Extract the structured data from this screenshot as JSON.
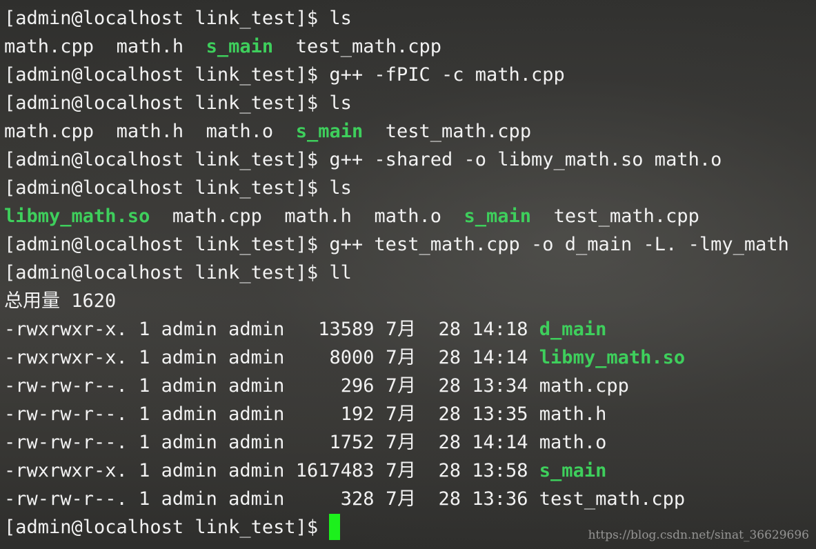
{
  "terminal": {
    "prompt": "[admin@localhost link_test]$ ",
    "lines": [
      {
        "kind": "cmd",
        "text": "ls"
      },
      {
        "kind": "ls",
        "items": [
          {
            "name": "math.cpp",
            "exec": false
          },
          {
            "name": "math.h",
            "exec": false
          },
          {
            "name": "s_main",
            "exec": true
          },
          {
            "name": "test_math.cpp",
            "exec": false
          }
        ]
      },
      {
        "kind": "cmd",
        "text": "g++ -fPIC -c math.cpp"
      },
      {
        "kind": "cmd",
        "text": "ls"
      },
      {
        "kind": "ls",
        "items": [
          {
            "name": "math.cpp",
            "exec": false
          },
          {
            "name": "math.h",
            "exec": false
          },
          {
            "name": "math.o",
            "exec": false
          },
          {
            "name": "s_main",
            "exec": true
          },
          {
            "name": "test_math.cpp",
            "exec": false
          }
        ]
      },
      {
        "kind": "cmd",
        "text": "g++ -shared -o libmy_math.so math.o"
      },
      {
        "kind": "cmd",
        "text": "ls"
      },
      {
        "kind": "ls",
        "items": [
          {
            "name": "libmy_math.so",
            "exec": true
          },
          {
            "name": "math.cpp",
            "exec": false
          },
          {
            "name": "math.h",
            "exec": false
          },
          {
            "name": "math.o",
            "exec": false
          },
          {
            "name": "s_main",
            "exec": true
          },
          {
            "name": "test_math.cpp",
            "exec": false
          }
        ]
      },
      {
        "kind": "cmd",
        "text": "g++ test_math.cpp -o d_main -L. -lmy_math"
      },
      {
        "kind": "cmd",
        "text": "ll"
      },
      {
        "kind": "total",
        "label": "总用量",
        "value": "1620"
      },
      {
        "kind": "ll",
        "perms": "-rwxrwxr-x.",
        "links": "1",
        "owner": "admin",
        "group": "admin",
        "size": "13589",
        "month": "7月",
        "day": "28",
        "time": "14:18",
        "name": "d_main",
        "exec": true
      },
      {
        "kind": "ll",
        "perms": "-rwxrwxr-x.",
        "links": "1",
        "owner": "admin",
        "group": "admin",
        "size": "8000",
        "month": "7月",
        "day": "28",
        "time": "14:14",
        "name": "libmy_math.so",
        "exec": true
      },
      {
        "kind": "ll",
        "perms": "-rw-rw-r--.",
        "links": "1",
        "owner": "admin",
        "group": "admin",
        "size": "296",
        "month": "7月",
        "day": "28",
        "time": "13:34",
        "name": "math.cpp",
        "exec": false
      },
      {
        "kind": "ll",
        "perms": "-rw-rw-r--.",
        "links": "1",
        "owner": "admin",
        "group": "admin",
        "size": "192",
        "month": "7月",
        "day": "28",
        "time": "13:35",
        "name": "math.h",
        "exec": false
      },
      {
        "kind": "ll",
        "perms": "-rw-rw-r--.",
        "links": "1",
        "owner": "admin",
        "group": "admin",
        "size": "1752",
        "month": "7月",
        "day": "28",
        "time": "14:14",
        "name": "math.o",
        "exec": false
      },
      {
        "kind": "ll",
        "perms": "-rwxrwxr-x.",
        "links": "1",
        "owner": "admin",
        "group": "admin",
        "size": "1617483",
        "month": "7月",
        "day": "28",
        "time": "13:58",
        "name": "s_main",
        "exec": true
      },
      {
        "kind": "ll",
        "perms": "-rw-rw-r--.",
        "links": "1",
        "owner": "admin",
        "group": "admin",
        "size": "328",
        "month": "7月",
        "day": "28",
        "time": "13:36",
        "name": "test_math.cpp",
        "exec": false
      },
      {
        "kind": "prompt_cursor"
      }
    ]
  },
  "colors": {
    "text": "#f2f2f2",
    "exec": "#3ecf5c",
    "cursor": "#1cf01c"
  },
  "watermark": "https://blog.csdn.net/sinat_36629696"
}
